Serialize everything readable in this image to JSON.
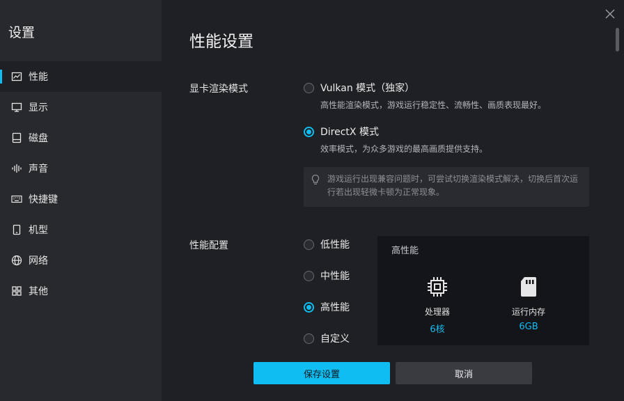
{
  "sidebar": {
    "title": "设置",
    "items": [
      {
        "label": "性能",
        "icon": "chart-line-icon",
        "active": true
      },
      {
        "label": "显示",
        "icon": "monitor-icon",
        "active": false
      },
      {
        "label": "磁盘",
        "icon": "disk-icon",
        "active": false
      },
      {
        "label": "声音",
        "icon": "sound-wave-icon",
        "active": false
      },
      {
        "label": "快捷键",
        "icon": "keyboard-icon",
        "active": false
      },
      {
        "label": "机型",
        "icon": "phone-icon",
        "active": false
      },
      {
        "label": "网络",
        "icon": "globe-icon",
        "active": false
      },
      {
        "label": "其他",
        "icon": "grid-icon",
        "active": false
      }
    ]
  },
  "page": {
    "title": "性能设置"
  },
  "render_mode": {
    "label": "显卡渲染模式",
    "options": [
      {
        "label": "Vulkan 模式（独家）",
        "desc": "高性能渲染模式，游戏运行稳定性、流畅性、画质表现最好。",
        "checked": false
      },
      {
        "label": "DirectX 模式",
        "desc": "效率模式，为众多游戏的最高画质提供支持。",
        "checked": true
      }
    ],
    "tip": "游戏运行出现兼容问题时，可尝试切换渲染模式解决，切换后首次运行若出现轻微卡顿为正常现象。",
    "tip_icon": "lightbulb-icon"
  },
  "perf_config": {
    "label": "性能配置",
    "options": [
      {
        "label": "低性能",
        "checked": false
      },
      {
        "label": "中性能",
        "checked": false
      },
      {
        "label": "高性能",
        "checked": true
      },
      {
        "label": "自定义",
        "checked": false
      }
    ],
    "card": {
      "title": "高性能",
      "cpu": {
        "name": "处理器",
        "value": "6核",
        "icon": "cpu-chip-icon"
      },
      "ram": {
        "name": "运行内存",
        "value": "6GB",
        "icon": "memory-card-icon"
      }
    }
  },
  "buttons": {
    "save": "保存设置",
    "cancel": "取消"
  },
  "colors": {
    "accent": "#10bdf2",
    "background": "#1f2024",
    "sidebar": "#28292d"
  }
}
